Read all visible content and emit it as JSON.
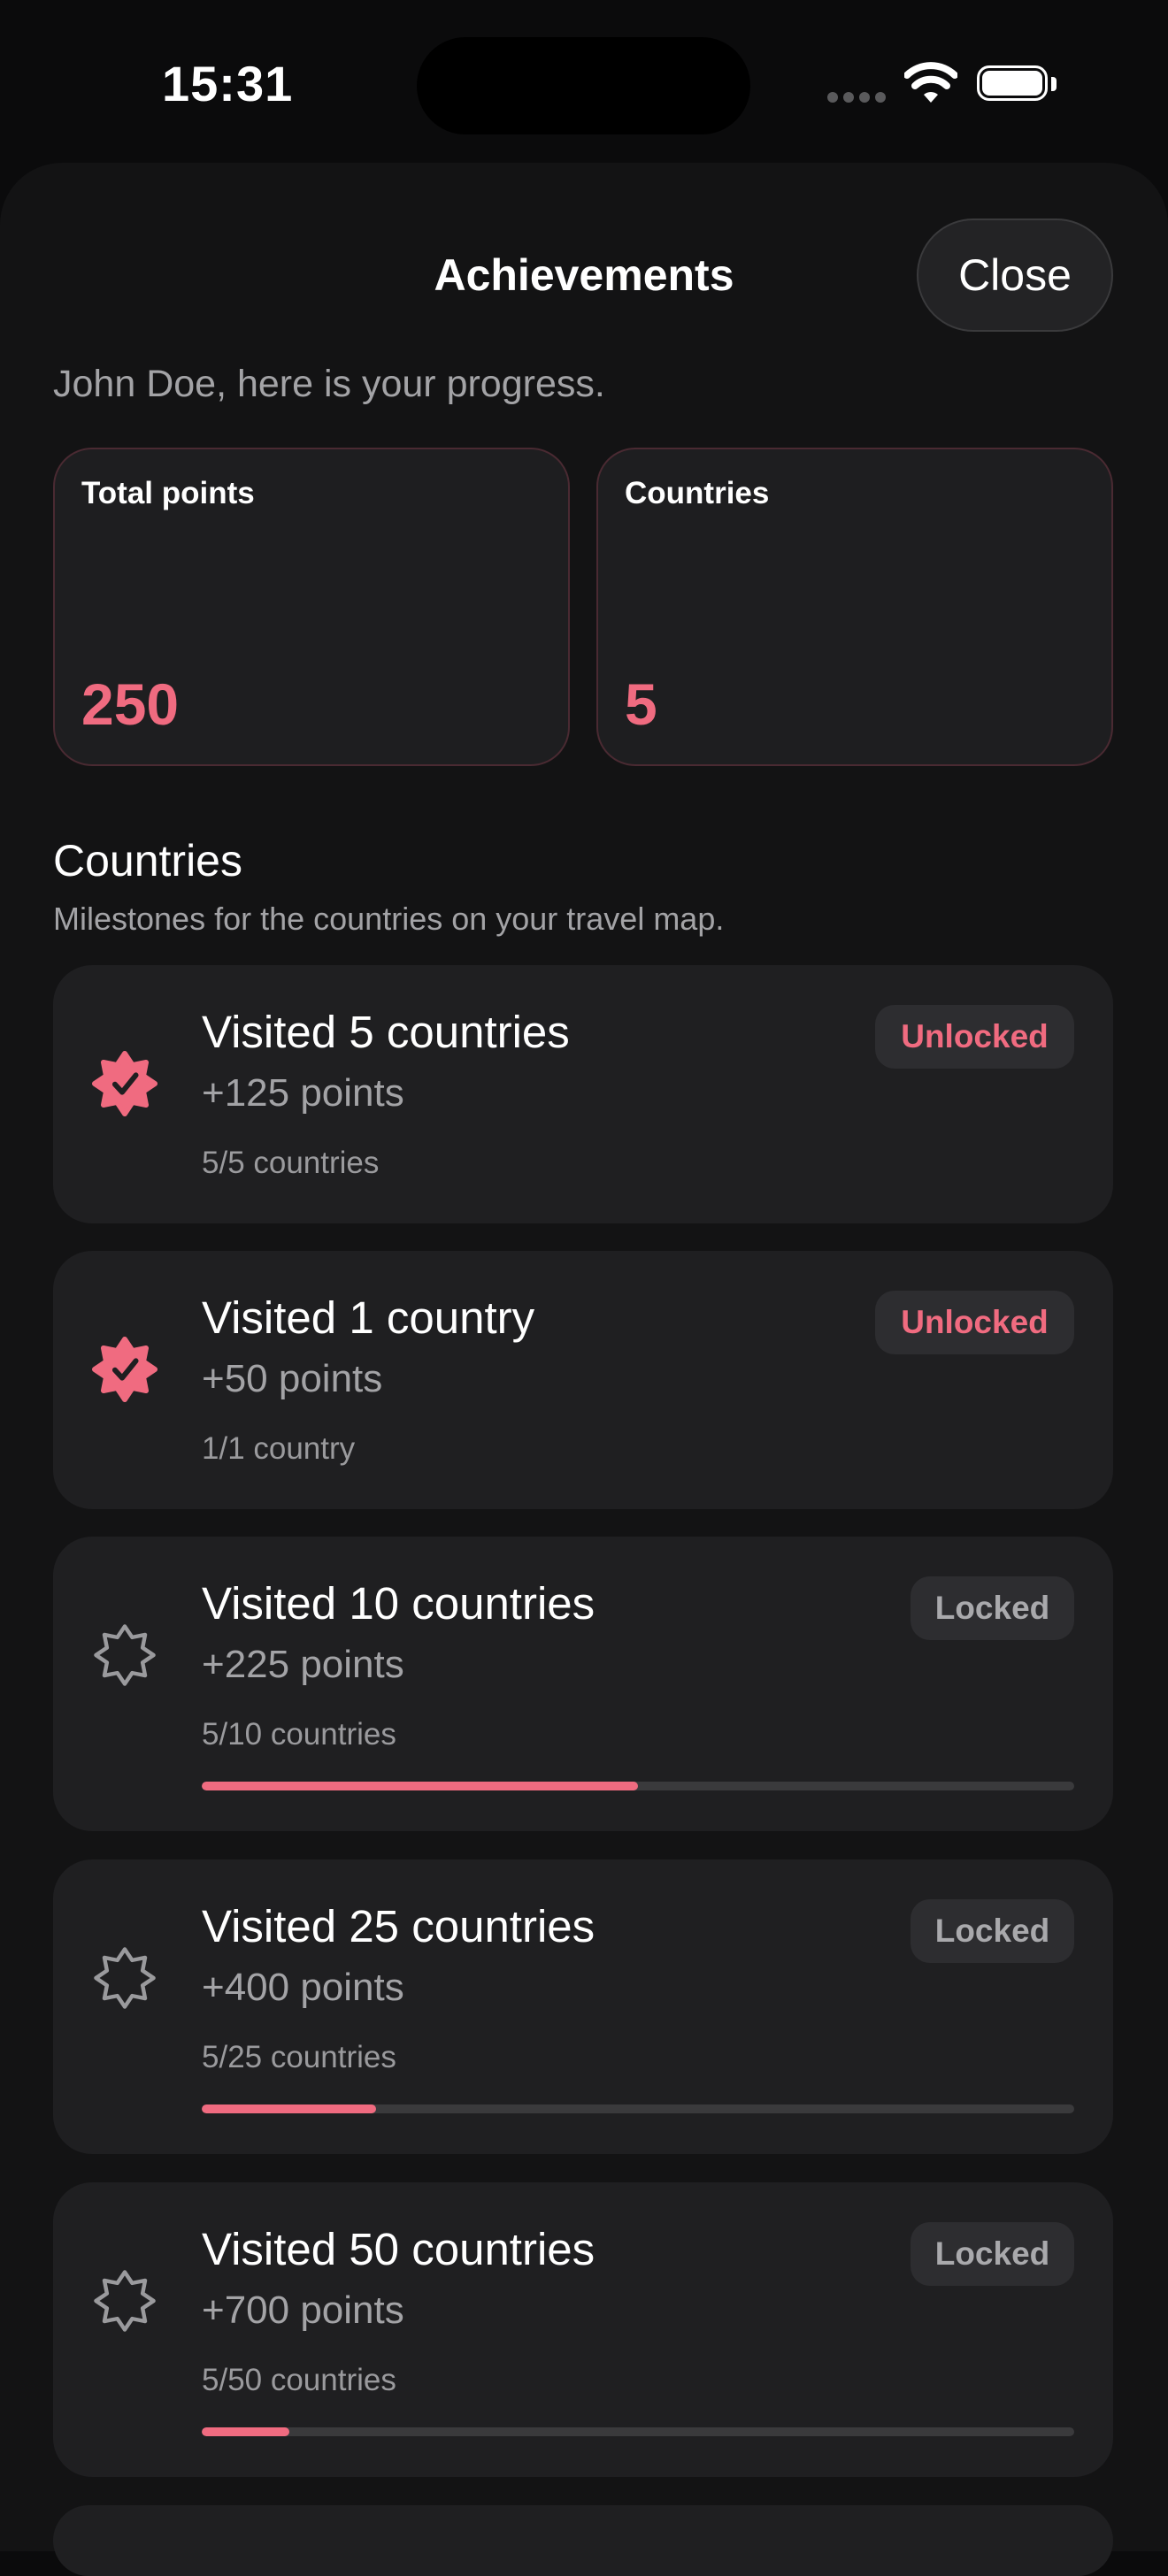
{
  "status": {
    "time": "15:31"
  },
  "header": {
    "title": "Achievements",
    "close_label": "Close"
  },
  "subtitle": "John Doe, here is your progress.",
  "stats": [
    {
      "label": "Total points",
      "value": "250"
    },
    {
      "label": "Countries",
      "value": "5"
    }
  ],
  "section": {
    "title": "Countries",
    "subtitle": "Milestones for the countries on your travel map."
  },
  "colors": {
    "accent": "#f06b80",
    "background": "#0b0b0c",
    "card": "#1f1f21"
  },
  "achievements": [
    {
      "title": "Visited 5 countries",
      "points": "+125 points",
      "progress_text": "5/5 countries",
      "status": "Unlocked",
      "icon": "verified-badge-icon",
      "progress": 1.0
    },
    {
      "title": "Visited 1 country",
      "points": "+50 points",
      "progress_text": "1/1 country",
      "status": "Unlocked",
      "icon": "verified-badge-icon",
      "progress": 1.0
    },
    {
      "title": "Visited 10 countries",
      "points": "+225 points",
      "progress_text": "5/10 countries",
      "status": "Locked",
      "icon": "badge-outline-icon",
      "progress": 0.5
    },
    {
      "title": "Visited 25 countries",
      "points": "+400 points",
      "progress_text": "5/25 countries",
      "status": "Locked",
      "icon": "badge-outline-icon",
      "progress": 0.2
    },
    {
      "title": "Visited 50 countries",
      "points": "+700 points",
      "progress_text": "5/50 countries",
      "status": "Locked",
      "icon": "badge-outline-icon",
      "progress": 0.1
    }
  ]
}
